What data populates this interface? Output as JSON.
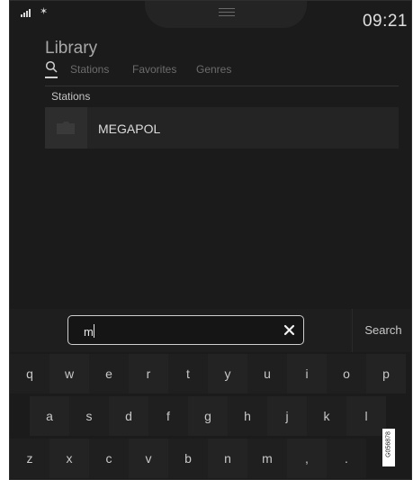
{
  "status": {
    "time": "09:21",
    "bluetooth": "✶"
  },
  "header": {
    "title": "Library",
    "tabs": [
      "Stations",
      "Favorites",
      "Genres"
    ]
  },
  "results": {
    "section_label": "Stations",
    "items": [
      {
        "name": "MEGAPOL"
      }
    ]
  },
  "search": {
    "value": "m",
    "button_label": "Search"
  },
  "keyboard": {
    "rows": [
      [
        "q",
        "w",
        "e",
        "r",
        "t",
        "y",
        "u",
        "i",
        "o",
        "p"
      ],
      [
        "a",
        "s",
        "d",
        "f",
        "g",
        "h",
        "j",
        "k",
        "l"
      ],
      [
        "z",
        "x",
        "c",
        "v",
        "b",
        "n",
        "m",
        ",",
        "."
      ]
    ]
  },
  "watermark": {
    "code": "G056878"
  },
  "icons": {
    "search": "search-icon",
    "clear": "close-icon",
    "folder": "folder-icon",
    "signal": "signal-icon",
    "bluetooth": "bluetooth-icon",
    "handle": "menu-handle-icon",
    "more": "chevron-right-icon"
  }
}
